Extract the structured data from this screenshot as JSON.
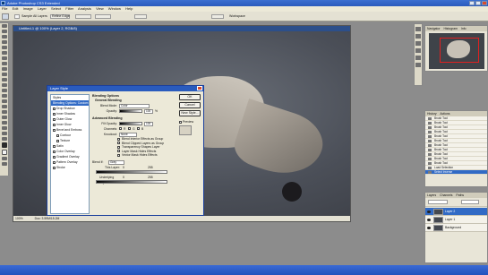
{
  "window": {
    "title": "Adobe Photoshop CS3 Extended"
  },
  "menu": [
    "File",
    "Edit",
    "Image",
    "Layer",
    "Select",
    "Filter",
    "Analysis",
    "View",
    "Window",
    "Help"
  ],
  "options": {
    "sample_label": "Sample All Layers",
    "refine_label": "Refine Edge",
    "workspace_label": "Workspace"
  },
  "document": {
    "tab_title": "Untitled-1 @ 100% (Layer 2, RGB/8)",
    "zoom": "100%",
    "doc_info": "Doc: 3.59M/15.2M"
  },
  "dialog": {
    "title": "Layer Style",
    "styles": [
      {
        "label": "Styles",
        "checkbox": false,
        "indent": false,
        "selected": false
      },
      {
        "label": "Blending Options: Custom",
        "checkbox": false,
        "indent": false,
        "selected": true
      },
      {
        "label": "Drop Shadow",
        "checkbox": true,
        "indent": false,
        "selected": false
      },
      {
        "label": "Inner Shadow",
        "checkbox": true,
        "indent": false,
        "selected": false
      },
      {
        "label": "Outer Glow",
        "checkbox": true,
        "indent": false,
        "selected": false
      },
      {
        "label": "Inner Glow",
        "checkbox": true,
        "indent": false,
        "selected": false
      },
      {
        "label": "Bevel and Emboss",
        "checkbox": true,
        "indent": false,
        "selected": false
      },
      {
        "label": "Contour",
        "checkbox": true,
        "indent": true,
        "selected": false
      },
      {
        "label": "Texture",
        "checkbox": true,
        "indent": true,
        "selected": false
      },
      {
        "label": "Satin",
        "checkbox": true,
        "indent": false,
        "selected": false
      },
      {
        "label": "Color Overlay",
        "checkbox": true,
        "indent": false,
        "selected": false
      },
      {
        "label": "Gradient Overlay",
        "checkbox": true,
        "indent": false,
        "selected": false
      },
      {
        "label": "Pattern Overlay",
        "checkbox": true,
        "indent": false,
        "selected": false
      },
      {
        "label": "Stroke",
        "checkbox": true,
        "indent": false,
        "selected": false
      }
    ],
    "blending_options": "Blending Options",
    "general_blending": "General Blending",
    "blend_mode_label": "Blend Mode:",
    "blend_mode_value": "Color",
    "opacity_label": "Opacity:",
    "opacity_value": "100",
    "opacity_unit": "%",
    "advanced_blending": "Advanced Blending",
    "fill_opacity_label": "Fill Opacity:",
    "fill_opacity_value": "100",
    "channels_label": "Channels:",
    "channels": [
      "R",
      "G",
      "B"
    ],
    "knockout_label": "Knockout:",
    "knockout_value": "None",
    "checks": [
      "Blend Interior Effects as Group",
      "Blend Clipped Layers as Group",
      "Transparency Shapes Layer",
      "Layer Mask Hides Effects",
      "Vector Mask Hides Effects"
    ],
    "blend_if_label": "Blend If:",
    "blend_if_value": "Gray",
    "this_layer_label": "This Layer:",
    "this_layer_low": "0",
    "this_layer_high": "255",
    "underlying_label": "Underlying Layer:",
    "underlying_low": "0",
    "underlying_high": "255",
    "ok_label": "OK",
    "cancel_label": "Cancel",
    "new_style_label": "New Style...",
    "preview_label": "Preview"
  },
  "navigator": {
    "tabs": [
      "Navigator",
      "Histogram",
      "Info"
    ]
  },
  "history": {
    "tabs": [
      "History",
      "Actions"
    ],
    "items": [
      {
        "label": "Brush Tool",
        "selected": false
      },
      {
        "label": "Brush Tool",
        "selected": false
      },
      {
        "label": "Brush Tool",
        "selected": false
      },
      {
        "label": "Brush Tool",
        "selected": false
      },
      {
        "label": "Brush Tool",
        "selected": false
      },
      {
        "label": "Brush Tool",
        "selected": false
      },
      {
        "label": "Brush Tool",
        "selected": false
      },
      {
        "label": "Brush Tool",
        "selected": false
      },
      {
        "label": "Brush Tool",
        "selected": false
      },
      {
        "label": "Brush Tool",
        "selected": false
      },
      {
        "label": "Brush Tool",
        "selected": false
      },
      {
        "label": "Load Selection",
        "selected": false
      },
      {
        "label": "Select Inverse",
        "selected": true
      }
    ]
  },
  "layers": {
    "tabs": [
      "Layers",
      "Channels",
      "Paths"
    ],
    "items": [
      {
        "label": "Layer 2",
        "selected": true
      },
      {
        "label": "Layer 1",
        "selected": false
      },
      {
        "label": "Background",
        "selected": false
      }
    ]
  },
  "colors": {
    "accent": "#316ac5",
    "titlebar": "#2a5bbd",
    "chrome": "#ece9d8"
  }
}
